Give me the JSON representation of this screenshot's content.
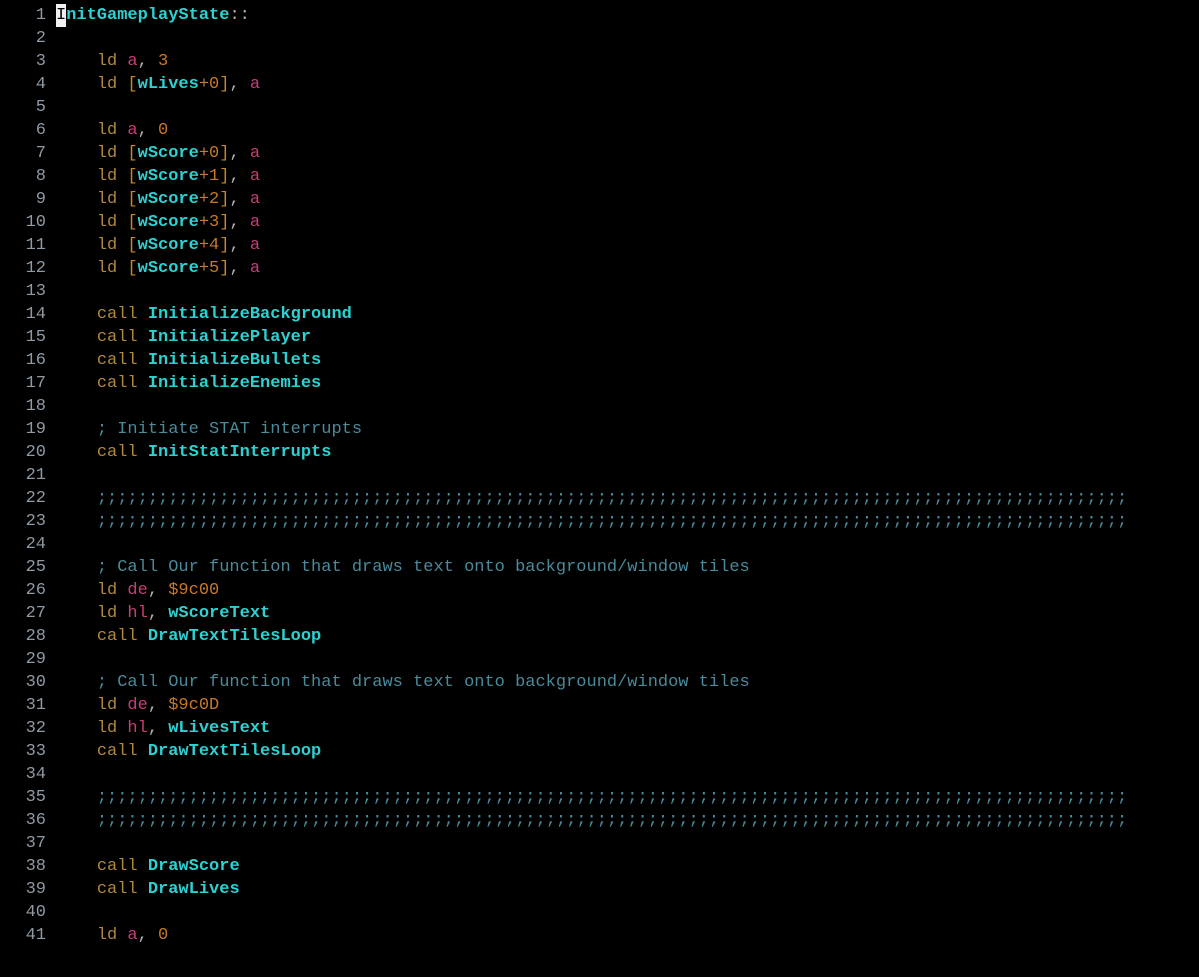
{
  "lines": [
    {
      "n": 1,
      "tokens": [
        {
          "t": "InitGameplayState",
          "c": "tok-label",
          "cursor_first": true
        },
        {
          "t": "::",
          "c": "tok-dcolon"
        }
      ]
    },
    {
      "n": 2,
      "tokens": []
    },
    {
      "n": 3,
      "tokens": [
        {
          "t": "    ",
          "c": ""
        },
        {
          "t": "ld",
          "c": "tok-mnem"
        },
        {
          "t": " ",
          "c": ""
        },
        {
          "t": "a",
          "c": "tok-reg"
        },
        {
          "t": ",",
          "c": "tok-punct"
        },
        {
          "t": " ",
          "c": ""
        },
        {
          "t": "3",
          "c": "tok-num"
        }
      ]
    },
    {
      "n": 4,
      "tokens": [
        {
          "t": "    ",
          "c": ""
        },
        {
          "t": "ld",
          "c": "tok-mnem"
        },
        {
          "t": " ",
          "c": ""
        },
        {
          "t": "[",
          "c": "tok-bracket"
        },
        {
          "t": "wLives",
          "c": "tok-ident"
        },
        {
          "t": "+",
          "c": "tok-plus"
        },
        {
          "t": "0",
          "c": "tok-num"
        },
        {
          "t": "]",
          "c": "tok-bracket"
        },
        {
          "t": ",",
          "c": "tok-punct"
        },
        {
          "t": " ",
          "c": ""
        },
        {
          "t": "a",
          "c": "tok-reg"
        }
      ]
    },
    {
      "n": 5,
      "tokens": []
    },
    {
      "n": 6,
      "tokens": [
        {
          "t": "    ",
          "c": ""
        },
        {
          "t": "ld",
          "c": "tok-mnem"
        },
        {
          "t": " ",
          "c": ""
        },
        {
          "t": "a",
          "c": "tok-reg"
        },
        {
          "t": ",",
          "c": "tok-punct"
        },
        {
          "t": " ",
          "c": ""
        },
        {
          "t": "0",
          "c": "tok-num"
        }
      ]
    },
    {
      "n": 7,
      "tokens": [
        {
          "t": "    ",
          "c": ""
        },
        {
          "t": "ld",
          "c": "tok-mnem"
        },
        {
          "t": " ",
          "c": ""
        },
        {
          "t": "[",
          "c": "tok-bracket"
        },
        {
          "t": "wScore",
          "c": "tok-ident"
        },
        {
          "t": "+",
          "c": "tok-plus"
        },
        {
          "t": "0",
          "c": "tok-num"
        },
        {
          "t": "]",
          "c": "tok-bracket"
        },
        {
          "t": ",",
          "c": "tok-punct"
        },
        {
          "t": " ",
          "c": ""
        },
        {
          "t": "a",
          "c": "tok-reg"
        }
      ]
    },
    {
      "n": 8,
      "tokens": [
        {
          "t": "    ",
          "c": ""
        },
        {
          "t": "ld",
          "c": "tok-mnem"
        },
        {
          "t": " ",
          "c": ""
        },
        {
          "t": "[",
          "c": "tok-bracket"
        },
        {
          "t": "wScore",
          "c": "tok-ident"
        },
        {
          "t": "+",
          "c": "tok-plus"
        },
        {
          "t": "1",
          "c": "tok-num"
        },
        {
          "t": "]",
          "c": "tok-bracket"
        },
        {
          "t": ",",
          "c": "tok-punct"
        },
        {
          "t": " ",
          "c": ""
        },
        {
          "t": "a",
          "c": "tok-reg"
        }
      ]
    },
    {
      "n": 9,
      "tokens": [
        {
          "t": "    ",
          "c": ""
        },
        {
          "t": "ld",
          "c": "tok-mnem"
        },
        {
          "t": " ",
          "c": ""
        },
        {
          "t": "[",
          "c": "tok-bracket"
        },
        {
          "t": "wScore",
          "c": "tok-ident"
        },
        {
          "t": "+",
          "c": "tok-plus"
        },
        {
          "t": "2",
          "c": "tok-num"
        },
        {
          "t": "]",
          "c": "tok-bracket"
        },
        {
          "t": ",",
          "c": "tok-punct"
        },
        {
          "t": " ",
          "c": ""
        },
        {
          "t": "a",
          "c": "tok-reg"
        }
      ]
    },
    {
      "n": 10,
      "tokens": [
        {
          "t": "    ",
          "c": ""
        },
        {
          "t": "ld",
          "c": "tok-mnem"
        },
        {
          "t": " ",
          "c": ""
        },
        {
          "t": "[",
          "c": "tok-bracket"
        },
        {
          "t": "wScore",
          "c": "tok-ident"
        },
        {
          "t": "+",
          "c": "tok-plus"
        },
        {
          "t": "3",
          "c": "tok-num"
        },
        {
          "t": "]",
          "c": "tok-bracket"
        },
        {
          "t": ",",
          "c": "tok-punct"
        },
        {
          "t": " ",
          "c": ""
        },
        {
          "t": "a",
          "c": "tok-reg"
        }
      ]
    },
    {
      "n": 11,
      "tokens": [
        {
          "t": "    ",
          "c": ""
        },
        {
          "t": "ld",
          "c": "tok-mnem"
        },
        {
          "t": " ",
          "c": ""
        },
        {
          "t": "[",
          "c": "tok-bracket"
        },
        {
          "t": "wScore",
          "c": "tok-ident"
        },
        {
          "t": "+",
          "c": "tok-plus"
        },
        {
          "t": "4",
          "c": "tok-num"
        },
        {
          "t": "]",
          "c": "tok-bracket"
        },
        {
          "t": ",",
          "c": "tok-punct"
        },
        {
          "t": " ",
          "c": ""
        },
        {
          "t": "a",
          "c": "tok-reg"
        }
      ]
    },
    {
      "n": 12,
      "tokens": [
        {
          "t": "    ",
          "c": ""
        },
        {
          "t": "ld",
          "c": "tok-mnem"
        },
        {
          "t": " ",
          "c": ""
        },
        {
          "t": "[",
          "c": "tok-bracket"
        },
        {
          "t": "wScore",
          "c": "tok-ident"
        },
        {
          "t": "+",
          "c": "tok-plus"
        },
        {
          "t": "5",
          "c": "tok-num"
        },
        {
          "t": "]",
          "c": "tok-bracket"
        },
        {
          "t": ",",
          "c": "tok-punct"
        },
        {
          "t": " ",
          "c": ""
        },
        {
          "t": "a",
          "c": "tok-reg"
        }
      ]
    },
    {
      "n": 13,
      "tokens": []
    },
    {
      "n": 14,
      "tokens": [
        {
          "t": "    ",
          "c": ""
        },
        {
          "t": "call",
          "c": "tok-mnem"
        },
        {
          "t": " ",
          "c": ""
        },
        {
          "t": "InitializeBackground",
          "c": "tok-ident"
        }
      ]
    },
    {
      "n": 15,
      "tokens": [
        {
          "t": "    ",
          "c": ""
        },
        {
          "t": "call",
          "c": "tok-mnem"
        },
        {
          "t": " ",
          "c": ""
        },
        {
          "t": "InitializePlayer",
          "c": "tok-ident"
        }
      ]
    },
    {
      "n": 16,
      "tokens": [
        {
          "t": "    ",
          "c": ""
        },
        {
          "t": "call",
          "c": "tok-mnem"
        },
        {
          "t": " ",
          "c": ""
        },
        {
          "t": "InitializeBullets",
          "c": "tok-ident"
        }
      ]
    },
    {
      "n": 17,
      "tokens": [
        {
          "t": "    ",
          "c": ""
        },
        {
          "t": "call",
          "c": "tok-mnem"
        },
        {
          "t": " ",
          "c": ""
        },
        {
          "t": "InitializeEnemies",
          "c": "tok-ident"
        }
      ]
    },
    {
      "n": 18,
      "tokens": []
    },
    {
      "n": 19,
      "tokens": [
        {
          "t": "    ",
          "c": ""
        },
        {
          "t": "; Initiate STAT interrupts",
          "c": "tok-comment"
        }
      ]
    },
    {
      "n": 20,
      "tokens": [
        {
          "t": "    ",
          "c": ""
        },
        {
          "t": "call",
          "c": "tok-mnem"
        },
        {
          "t": " ",
          "c": ""
        },
        {
          "t": "InitStatInterrupts",
          "c": "tok-ident"
        }
      ]
    },
    {
      "n": 21,
      "tokens": []
    },
    {
      "n": 22,
      "tokens": [
        {
          "t": "    ",
          "c": ""
        },
        {
          "t": ";;;;;;;;;;;;;;;;;;;;;;;;;;;;;;;;;;;;;;;;;;;;;;;;;;;;;;;;;;;;;;;;;;;;;;;;;;;;;;;;;;;;;;;;;;;;;;;;;;;;;",
          "c": "tok-comment"
        }
      ]
    },
    {
      "n": 23,
      "tokens": [
        {
          "t": "    ",
          "c": ""
        },
        {
          "t": ";;;;;;;;;;;;;;;;;;;;;;;;;;;;;;;;;;;;;;;;;;;;;;;;;;;;;;;;;;;;;;;;;;;;;;;;;;;;;;;;;;;;;;;;;;;;;;;;;;;;;",
          "c": "tok-comment"
        }
      ]
    },
    {
      "n": 24,
      "tokens": []
    },
    {
      "n": 25,
      "tokens": [
        {
          "t": "    ",
          "c": ""
        },
        {
          "t": "; Call Our function that draws text onto background/window tiles",
          "c": "tok-comment"
        }
      ]
    },
    {
      "n": 26,
      "tokens": [
        {
          "t": "    ",
          "c": ""
        },
        {
          "t": "ld",
          "c": "tok-mnem"
        },
        {
          "t": " ",
          "c": ""
        },
        {
          "t": "de",
          "c": "tok-reg"
        },
        {
          "t": ",",
          "c": "tok-punct"
        },
        {
          "t": " ",
          "c": ""
        },
        {
          "t": "$9c00",
          "c": "tok-hex"
        }
      ]
    },
    {
      "n": 27,
      "tokens": [
        {
          "t": "    ",
          "c": ""
        },
        {
          "t": "ld",
          "c": "tok-mnem"
        },
        {
          "t": " ",
          "c": ""
        },
        {
          "t": "hl",
          "c": "tok-reg"
        },
        {
          "t": ",",
          "c": "tok-punct"
        },
        {
          "t": " ",
          "c": ""
        },
        {
          "t": "wScoreText",
          "c": "tok-ident"
        }
      ]
    },
    {
      "n": 28,
      "tokens": [
        {
          "t": "    ",
          "c": ""
        },
        {
          "t": "call",
          "c": "tok-mnem"
        },
        {
          "t": " ",
          "c": ""
        },
        {
          "t": "DrawTextTilesLoop",
          "c": "tok-ident"
        }
      ]
    },
    {
      "n": 29,
      "tokens": []
    },
    {
      "n": 30,
      "tokens": [
        {
          "t": "    ",
          "c": ""
        },
        {
          "t": "; Call Our function that draws text onto background/window tiles",
          "c": "tok-comment"
        }
      ]
    },
    {
      "n": 31,
      "tokens": [
        {
          "t": "    ",
          "c": ""
        },
        {
          "t": "ld",
          "c": "tok-mnem"
        },
        {
          "t": " ",
          "c": ""
        },
        {
          "t": "de",
          "c": "tok-reg"
        },
        {
          "t": ",",
          "c": "tok-punct"
        },
        {
          "t": " ",
          "c": ""
        },
        {
          "t": "$9c0D",
          "c": "tok-hex"
        }
      ]
    },
    {
      "n": 32,
      "tokens": [
        {
          "t": "    ",
          "c": ""
        },
        {
          "t": "ld",
          "c": "tok-mnem"
        },
        {
          "t": " ",
          "c": ""
        },
        {
          "t": "hl",
          "c": "tok-reg"
        },
        {
          "t": ",",
          "c": "tok-punct"
        },
        {
          "t": " ",
          "c": ""
        },
        {
          "t": "wLivesText",
          "c": "tok-ident"
        }
      ]
    },
    {
      "n": 33,
      "tokens": [
        {
          "t": "    ",
          "c": ""
        },
        {
          "t": "call",
          "c": "tok-mnem"
        },
        {
          "t": " ",
          "c": ""
        },
        {
          "t": "DrawTextTilesLoop",
          "c": "tok-ident"
        }
      ]
    },
    {
      "n": 34,
      "tokens": []
    },
    {
      "n": 35,
      "tokens": [
        {
          "t": "    ",
          "c": ""
        },
        {
          "t": ";;;;;;;;;;;;;;;;;;;;;;;;;;;;;;;;;;;;;;;;;;;;;;;;;;;;;;;;;;;;;;;;;;;;;;;;;;;;;;;;;;;;;;;;;;;;;;;;;;;;;",
          "c": "tok-comment"
        }
      ]
    },
    {
      "n": 36,
      "tokens": [
        {
          "t": "    ",
          "c": ""
        },
        {
          "t": ";;;;;;;;;;;;;;;;;;;;;;;;;;;;;;;;;;;;;;;;;;;;;;;;;;;;;;;;;;;;;;;;;;;;;;;;;;;;;;;;;;;;;;;;;;;;;;;;;;;;;",
          "c": "tok-comment"
        }
      ]
    },
    {
      "n": 37,
      "tokens": []
    },
    {
      "n": 38,
      "tokens": [
        {
          "t": "    ",
          "c": ""
        },
        {
          "t": "call",
          "c": "tok-mnem"
        },
        {
          "t": " ",
          "c": ""
        },
        {
          "t": "DrawScore",
          "c": "tok-ident"
        }
      ]
    },
    {
      "n": 39,
      "tokens": [
        {
          "t": "    ",
          "c": ""
        },
        {
          "t": "call",
          "c": "tok-mnem"
        },
        {
          "t": " ",
          "c": ""
        },
        {
          "t": "DrawLives",
          "c": "tok-ident"
        }
      ]
    },
    {
      "n": 40,
      "tokens": []
    },
    {
      "n": 41,
      "tokens": [
        {
          "t": "    ",
          "c": ""
        },
        {
          "t": "ld",
          "c": "tok-mnem"
        },
        {
          "t": " ",
          "c": ""
        },
        {
          "t": "a",
          "c": "tok-reg"
        },
        {
          "t": ",",
          "c": "tok-punct"
        },
        {
          "t": " ",
          "c": ""
        },
        {
          "t": "0",
          "c": "tok-num"
        }
      ]
    }
  ]
}
